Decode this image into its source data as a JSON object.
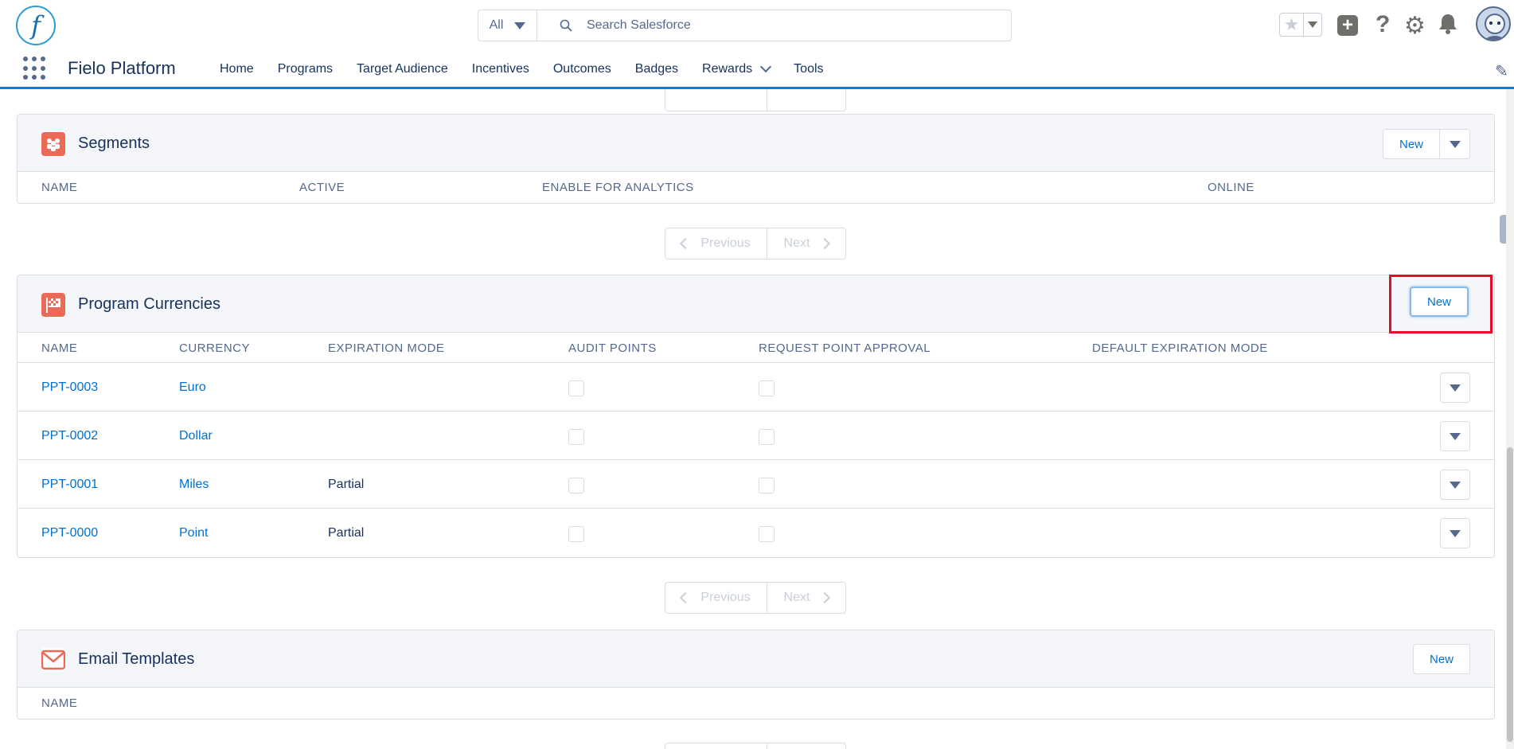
{
  "header": {
    "logo_letter": "f",
    "search": {
      "scope": "All",
      "placeholder": "Search Salesforce",
      "value": ""
    }
  },
  "nav": {
    "app_name": "Fielo Platform",
    "items": [
      {
        "label": "Home"
      },
      {
        "label": "Programs"
      },
      {
        "label": "Target Audience"
      },
      {
        "label": "Incentives"
      },
      {
        "label": "Outcomes"
      },
      {
        "label": "Badges"
      },
      {
        "label": "Rewards",
        "has_menu": true
      },
      {
        "label": "Tools"
      }
    ]
  },
  "segments": {
    "title": "Segments",
    "new_label": "New",
    "columns": [
      "NAME",
      "ACTIVE",
      "ENABLE FOR ANALYTICS",
      "ONLINE"
    ]
  },
  "pager": {
    "previous": "Previous",
    "next": "Next"
  },
  "program_currencies": {
    "title": "Program Currencies",
    "new_label": "New",
    "columns": [
      "NAME",
      "CURRENCY",
      "EXPIRATION MODE",
      "AUDIT POINTS",
      "REQUEST POINT APPROVAL",
      "DEFAULT EXPIRATION MODE"
    ],
    "rows": [
      {
        "name": "PPT-0003",
        "currency": "Euro",
        "expiration_mode": "",
        "audit_points": false,
        "request_point_approval": false,
        "default_expiration_mode": ""
      },
      {
        "name": "PPT-0002",
        "currency": "Dollar",
        "expiration_mode": "",
        "audit_points": false,
        "request_point_approval": false,
        "default_expiration_mode": ""
      },
      {
        "name": "PPT-0001",
        "currency": "Miles",
        "expiration_mode": "Partial",
        "audit_points": false,
        "request_point_approval": false,
        "default_expiration_mode": ""
      },
      {
        "name": "PPT-0000",
        "currency": "Point",
        "expiration_mode": "Partial",
        "audit_points": false,
        "request_point_approval": false,
        "default_expiration_mode": ""
      }
    ]
  },
  "email_templates": {
    "title": "Email Templates",
    "new_label": "New",
    "columns": [
      "NAME"
    ]
  },
  "colors": {
    "brand_blue": "#0070d2",
    "card_icon": "#e96b57",
    "highlight": "#e0102a"
  }
}
